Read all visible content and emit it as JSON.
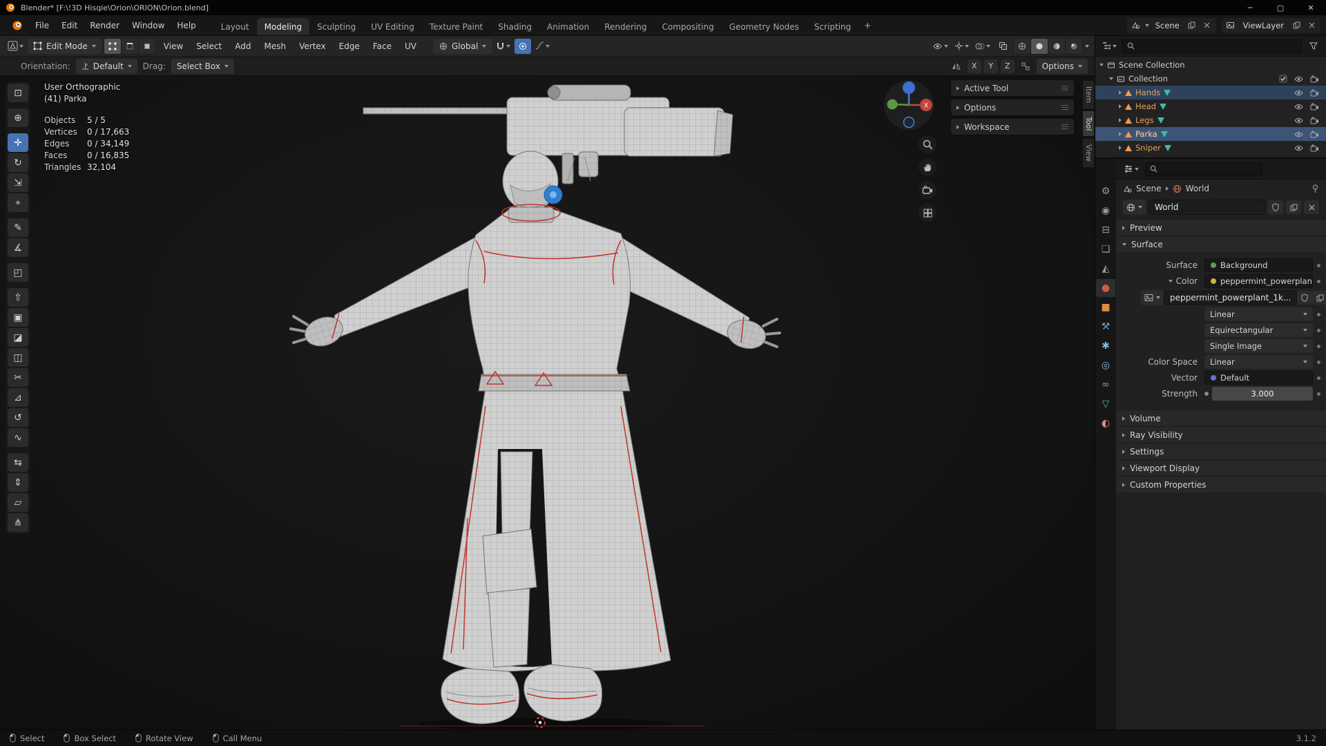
{
  "window": {
    "title": "Blender* [F:\\!3D Hisqie\\Orion\\ORION\\Orion.blend]",
    "minimize": "─",
    "maximize": "▢",
    "close": "✕"
  },
  "topbar": {
    "menus": [
      {
        "label": "File"
      },
      {
        "label": "Edit"
      },
      {
        "label": "Render"
      },
      {
        "label": "Window"
      },
      {
        "label": "Help"
      }
    ],
    "tabs": [
      {
        "label": "Layout"
      },
      {
        "label": "Modeling",
        "active": true
      },
      {
        "label": "Sculpting"
      },
      {
        "label": "UV Editing"
      },
      {
        "label": "Texture Paint"
      },
      {
        "label": "Shading"
      },
      {
        "label": "Animation"
      },
      {
        "label": "Rendering"
      },
      {
        "label": "Compositing"
      },
      {
        "label": "Geometry Nodes"
      },
      {
        "label": "Scripting"
      }
    ],
    "add_tab_label": "+",
    "scene": "Scene",
    "viewlayer": "ViewLayer"
  },
  "viewport_header": {
    "mode": "Edit Mode",
    "menus": [
      {
        "label": "View"
      },
      {
        "label": "Select"
      },
      {
        "label": "Add"
      },
      {
        "label": "Mesh"
      },
      {
        "label": "Vertex"
      },
      {
        "label": "Edge"
      },
      {
        "label": "Face"
      },
      {
        "label": "UV"
      }
    ],
    "orientation": "Global"
  },
  "tool_settings": {
    "orientation_label": "Orientation:",
    "orientation_value": "Default",
    "drag_label": "Drag:",
    "drag_value": "Select Box",
    "axes": [
      {
        "label": "X"
      },
      {
        "label": "Y"
      },
      {
        "label": "Z"
      }
    ],
    "options_label": "Options"
  },
  "toolbar": {
    "tools": [
      {
        "name": "select-box",
        "glyph": "⊡"
      },
      {
        "name": "cursor",
        "glyph": "⊕"
      },
      {
        "name": "move",
        "glyph": "✛",
        "active": true
      },
      {
        "name": "rotate",
        "glyph": "↻"
      },
      {
        "name": "scale",
        "glyph": "⇲"
      },
      {
        "name": "transform",
        "glyph": "⌖"
      },
      {
        "name": "annotate",
        "glyph": "✎"
      },
      {
        "name": "measure",
        "glyph": "∡"
      },
      {
        "name": "add-cube",
        "glyph": "◰"
      },
      {
        "name": "extrude-region",
        "glyph": "⇧"
      },
      {
        "name": "inset-faces",
        "glyph": "▣"
      },
      {
        "name": "bevel",
        "glyph": "◪"
      },
      {
        "name": "loop-cut",
        "glyph": "◫"
      },
      {
        "name": "knife",
        "glyph": "✂"
      },
      {
        "name": "poly-build",
        "glyph": "⊿"
      },
      {
        "name": "spin",
        "glyph": "↺"
      },
      {
        "name": "smooth",
        "glyph": "∿"
      },
      {
        "name": "edge-slide",
        "glyph": "⇆"
      },
      {
        "name": "shrink-fatten",
        "glyph": "⇕"
      },
      {
        "name": "shear",
        "glyph": "▱"
      },
      {
        "name": "rip-region",
        "glyph": "⋔"
      }
    ]
  },
  "viewport": {
    "view_name": "User Orthographic",
    "object_name": "(41) Parka",
    "stats": [
      {
        "label": "Objects",
        "value": "5 / 5"
      },
      {
        "label": "Vertices",
        "value": "0 / 17,663"
      },
      {
        "label": "Edges",
        "value": "0 / 34,149"
      },
      {
        "label": "Faces",
        "value": "0 / 16,835"
      },
      {
        "label": "Triangles",
        "value": "32,104"
      }
    ],
    "gizmo": {
      "x_label": "X"
    },
    "float_panels": [
      {
        "label": "Active Tool"
      },
      {
        "label": "Options"
      },
      {
        "label": "Workspace"
      }
    ],
    "side_tabs": [
      {
        "label": "Item"
      },
      {
        "label": "Tool",
        "active": true
      },
      {
        "label": "View"
      }
    ]
  },
  "outliner": {
    "root_label": "Scene Collection",
    "collection_label": "Collection",
    "items": [
      {
        "name": "Hands",
        "selected": true
      },
      {
        "name": "Head"
      },
      {
        "name": "Legs"
      },
      {
        "name": "Parka",
        "selected": true,
        "active": true
      },
      {
        "name": "Sniper"
      }
    ]
  },
  "properties": {
    "breadcrumb": {
      "scene": "Scene",
      "world": "World"
    },
    "world_name": "World",
    "preview_label": "Preview",
    "surface": {
      "title": "Surface",
      "surface_label": "Surface",
      "surface_value": "Background",
      "color_label": "Color",
      "color_value": "peppermint_powerplant...",
      "image_name": "peppermint_powerplant_1k...",
      "interpolation": "Linear",
      "projection": "Equirectangular",
      "source": "Single Image",
      "color_space_label": "Color Space",
      "color_space_value": "Linear",
      "vector_label": "Vector",
      "vector_value": "Default",
      "strength_label": "Strength",
      "strength_value": "3.000"
    },
    "collapsed_panels": [
      {
        "label": "Volume"
      },
      {
        "label": "Ray Visibility"
      },
      {
        "label": "Settings"
      },
      {
        "label": "Viewport Display"
      },
      {
        "label": "Custom Properties"
      }
    ],
    "tabs": [
      {
        "name": "tool",
        "glyph": "⚙",
        "color": "#9a9a9a"
      },
      {
        "name": "render",
        "glyph": "◉",
        "color": "#9a9a9a"
      },
      {
        "name": "output",
        "glyph": "⊟",
        "color": "#9a9a9a"
      },
      {
        "name": "view-layer",
        "glyph": "❏",
        "color": "#9a9a9a"
      },
      {
        "name": "scene",
        "glyph": "◭",
        "color": "#9a9a9a"
      },
      {
        "name": "world",
        "glyph": "●",
        "color": "#cf5c47",
        "active": true
      },
      {
        "name": "object",
        "glyph": "■",
        "color": "#e08c43"
      },
      {
        "name": "modifiers",
        "glyph": "⚒",
        "color": "#6f9fd4"
      },
      {
        "name": "particles",
        "glyph": "✱",
        "color": "#7fb8e0"
      },
      {
        "name": "physics",
        "glyph": "◎",
        "color": "#7fb8e0"
      },
      {
        "name": "constraints",
        "glyph": "∞",
        "color": "#9a9a9a"
      },
      {
        "name": "object-data",
        "glyph": "▽",
        "color": "#48b596"
      },
      {
        "name": "material",
        "glyph": "◐",
        "color": "#d88a8a"
      }
    ]
  },
  "statusbar": {
    "hints": [
      {
        "label": "Select"
      },
      {
        "label": "Box Select"
      },
      {
        "label": "Rotate View"
      },
      {
        "label": "Call Menu"
      }
    ],
    "version": "3.1.2"
  },
  "colors": {
    "accent": "#4772b3",
    "selection_orange": "#e8a25c"
  }
}
